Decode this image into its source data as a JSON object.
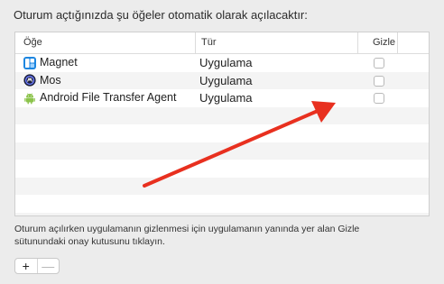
{
  "heading": "Oturum açtığınızda şu öğeler otomatik olarak açılacaktır:",
  "table": {
    "columns": {
      "item": "Öğe",
      "type": "Tür",
      "hide": "Gizle"
    },
    "rows": [
      {
        "name": "Magnet",
        "type": "Uygulama",
        "icon": "magnet-app-icon",
        "hidden": false
      },
      {
        "name": "Mos",
        "type": "Uygulama",
        "icon": "mos-app-icon",
        "hidden": false
      },
      {
        "name": "Android File Transfer Agent",
        "type": "Uygulama",
        "icon": "android-app-icon",
        "hidden": false
      }
    ]
  },
  "hint": "Oturum açılırken uygulamanın gizlenmesi için uygulamanın yanında yer alan Gizle sütunundaki onay kutusunu tıklayın.",
  "buttons": {
    "add": "+",
    "remove": "—"
  },
  "colors": {
    "annotation_arrow": "#e8301f",
    "row_alt": "#f4f4f4",
    "background": "#ececec"
  }
}
